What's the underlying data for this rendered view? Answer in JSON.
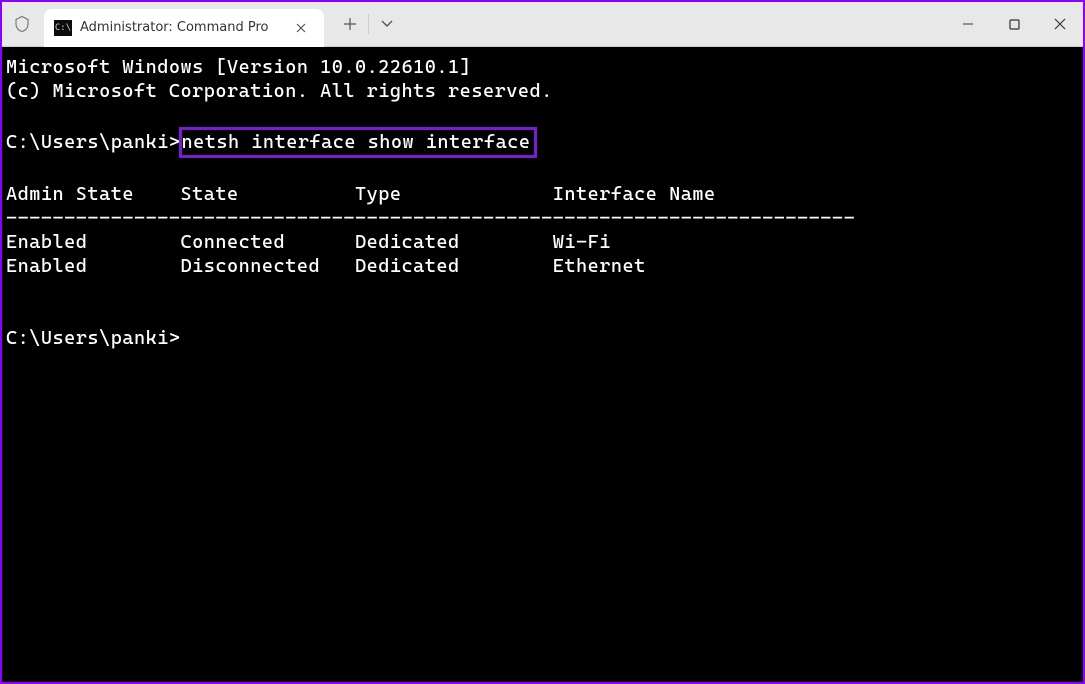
{
  "titlebar": {
    "tab_title": "Administrator: Command Pro",
    "tab_close": "✕",
    "plus": "+",
    "dropdown": "⌄",
    "minimize": "—",
    "maximize": "☐",
    "close": "✕"
  },
  "terminal": {
    "line1": "Microsoft Windows [Version 10.0.22610.1]",
    "line2": "(c) Microsoft Corporation. All rights reserved.",
    "prompt1_prefix": "C:\\Users\\panki>",
    "command_highlighted": "netsh interface show interface",
    "header": "Admin State    State          Type             Interface Name",
    "separator": "-------------------------------------------------------------------------",
    "row1": "Enabled        Connected      Dedicated        Wi-Fi",
    "row2": "Enabled        Disconnected   Dedicated        Ethernet",
    "prompt2": "C:\\Users\\panki>"
  }
}
